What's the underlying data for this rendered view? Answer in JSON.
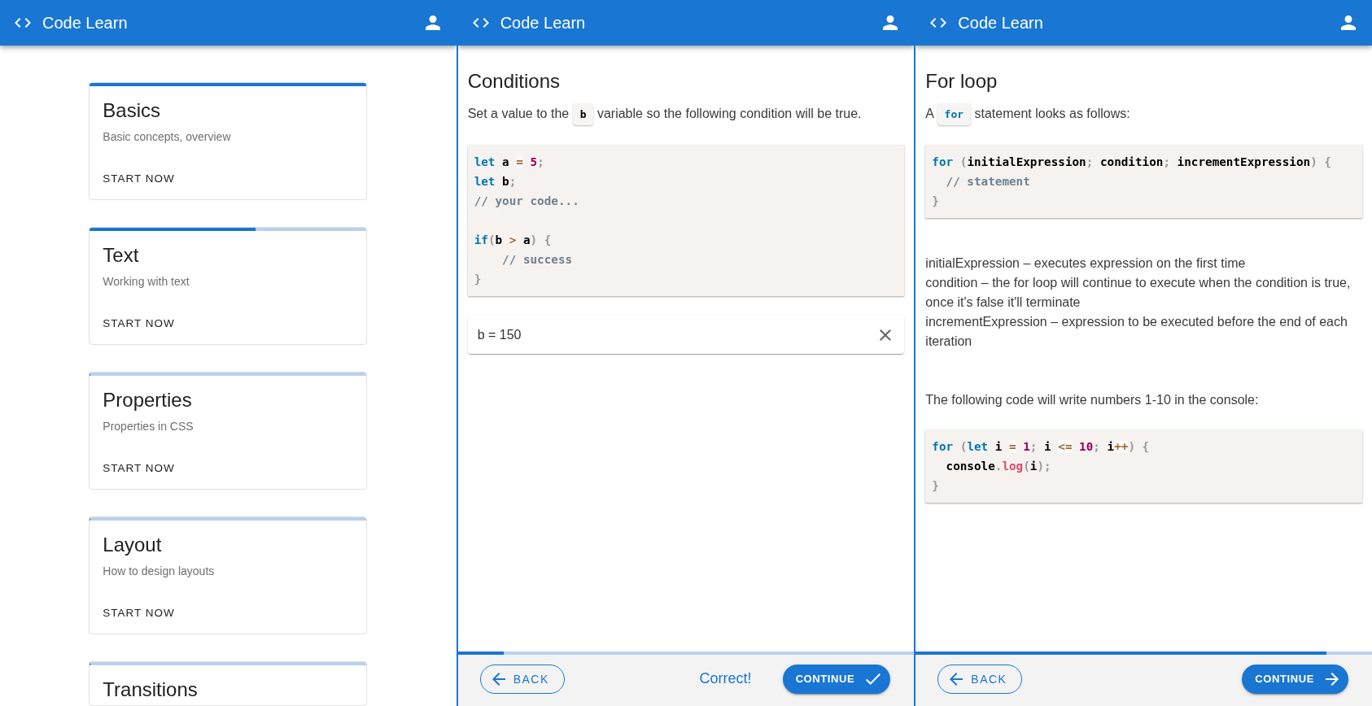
{
  "panels": [
    {
      "kind": "courses",
      "app_bar": {
        "title": "Code Learn"
      },
      "cards": [
        {
          "title": "Basics",
          "subtitle": "Basic concepts, overview",
          "action": "START NOW",
          "level": 1
        },
        {
          "title": "Text",
          "subtitle": "Working with text",
          "action": "START NOW",
          "level": 0.6
        },
        {
          "title": "Properties",
          "subtitle": "Properties in CSS",
          "action": "START NOW",
          "level": 0
        },
        {
          "title": "Layout",
          "subtitle": "How to design layouts",
          "action": "START NOW",
          "level": 0
        },
        {
          "title": "Transitions",
          "level": 0
        }
      ]
    },
    {
      "kind": "lesson",
      "app_bar": {
        "title": "Code Learn"
      },
      "title": "Conditions",
      "blocks": [
        {
          "kind": "paragraph",
          "parts": [
            {
              "kind": "text",
              "text": "Set a value to the"
            },
            {
              "kind": "code",
              "tokens": [
                {
                  "kind": "plain",
                  "text": "b"
                }
              ]
            },
            {
              "kind": "text",
              "text": "variable so the following condition will be true."
            }
          ]
        },
        {
          "kind": "code",
          "lines": [
            {
              "kind": "code",
              "tokens": [
                {
                  "kind": "keyword",
                  "text": "let"
                },
                {
                  "kind": "plain",
                  "text": " a "
                },
                {
                  "kind": "operator",
                  "text": "="
                },
                {
                  "kind": "number",
                  "text": " 5"
                },
                {
                  "kind": "punctuation",
                  "text": ";"
                }
              ]
            },
            {
              "kind": "code",
              "tokens": [
                {
                  "kind": "keyword",
                  "text": "let"
                },
                {
                  "kind": "plain",
                  "text": " b"
                },
                {
                  "kind": "punctuation",
                  "text": ";"
                }
              ]
            },
            {
              "kind": "code",
              "tokens": [
                {
                  "kind": "comment",
                  "text": "// your code..."
                }
              ]
            },
            {
              "kind": "blank"
            },
            {
              "kind": "code",
              "tokens": [
                {
                  "kind": "keyword",
                  "text": "if"
                },
                {
                  "kind": "punctuation",
                  "text": "("
                },
                {
                  "kind": "plain",
                  "text": "b "
                },
                {
                  "kind": "operator",
                  "text": ">"
                },
                {
                  "kind": "plain",
                  "text": " a"
                },
                {
                  "kind": "punctuation",
                  "text": ")"
                },
                {
                  "kind": "punctuation",
                  "text": " {"
                }
              ]
            },
            {
              "kind": "code",
              "tokens": [
                {
                  "kind": "comment",
                  "text": "    // success"
                }
              ]
            },
            {
              "kind": "code",
              "tokens": [
                {
                  "kind": "punctuation",
                  "text": "}"
                }
              ]
            }
          ]
        },
        {
          "kind": "answer",
          "value": "b = 150"
        }
      ],
      "progress": {
        "level": 0.1
      },
      "footer": {
        "back": "BACK",
        "status": "Correct!",
        "continue": "CONTINUE",
        "solved": true
      }
    },
    {
      "kind": "lesson",
      "app_bar": {
        "title": "Code Learn"
      },
      "title": "For loop",
      "blocks": [
        {
          "kind": "paragraph",
          "parts": [
            {
              "kind": "text",
              "text": "A"
            },
            {
              "kind": "code",
              "tokens": [
                {
                  "kind": "keyword",
                  "text": "for"
                }
              ]
            },
            {
              "kind": "text",
              "text": "statement looks as follows:"
            }
          ]
        },
        {
          "kind": "code",
          "lines": [
            {
              "kind": "code",
              "tokens": [
                {
                  "kind": "keyword",
                  "text": "for"
                },
                {
                  "kind": "punctuation",
                  "text": " ("
                },
                {
                  "kind": "plain",
                  "text": "initialExpression"
                },
                {
                  "kind": "punctuation",
                  "text": ";"
                },
                {
                  "kind": "plain",
                  "text": " condition"
                },
                {
                  "kind": "punctuation",
                  "text": ";"
                },
                {
                  "kind": "plain",
                  "text": " incrementExpression"
                },
                {
                  "kind": "punctuation",
                  "text": ")"
                },
                {
                  "kind": "punctuation",
                  "text": " {"
                }
              ]
            },
            {
              "kind": "code",
              "tokens": [
                {
                  "kind": "comment",
                  "text": "  // statement"
                }
              ]
            },
            {
              "kind": "code",
              "tokens": [
                {
                  "kind": "punctuation",
                  "text": "}"
                }
              ]
            }
          ]
        },
        {
          "kind": "definitions",
          "lines": [
            "initialExpression – executes expression on the first time",
            "condition – the for loop will continue to execute when the condition is true, once it's false it'll terminate",
            "incrementExpression – expression to be executed before the end of each iteration"
          ]
        },
        {
          "kind": "paragraph",
          "parts": [
            {
              "kind": "text",
              "text": "The following code will write numbers 1-10 in the console:"
            }
          ]
        },
        {
          "kind": "code",
          "lines": [
            {
              "kind": "code",
              "tokens": [
                {
                  "kind": "keyword",
                  "text": "for"
                },
                {
                  "kind": "punctuation",
                  "text": " ("
                },
                {
                  "kind": "keyword",
                  "text": "let"
                },
                {
                  "kind": "plain",
                  "text": " i "
                },
                {
                  "kind": "operator",
                  "text": "="
                },
                {
                  "kind": "number",
                  "text": " 1"
                },
                {
                  "kind": "punctuation",
                  "text": ";"
                },
                {
                  "kind": "plain",
                  "text": " i "
                },
                {
                  "kind": "operator",
                  "text": "<="
                },
                {
                  "kind": "number",
                  "text": " 10"
                },
                {
                  "kind": "punctuation",
                  "text": ";"
                },
                {
                  "kind": "plain",
                  "text": " i"
                },
                {
                  "kind": "operator",
                  "text": "++"
                },
                {
                  "kind": "punctuation",
                  "text": ")"
                },
                {
                  "kind": "punctuation",
                  "text": " {"
                }
              ]
            },
            {
              "kind": "code",
              "tokens": [
                {
                  "kind": "plain",
                  "text": "  console"
                },
                {
                  "kind": "punctuation",
                  "text": "."
                },
                {
                  "kind": "function",
                  "text": "log"
                },
                {
                  "kind": "punctuation",
                  "text": "("
                },
                {
                  "kind": "plain",
                  "text": "i"
                },
                {
                  "kind": "punctuation",
                  "text": ")"
                },
                {
                  "kind": "punctuation",
                  "text": ";"
                }
              ]
            },
            {
              "kind": "code",
              "tokens": [
                {
                  "kind": "punctuation",
                  "text": "}"
                }
              ]
            }
          ]
        }
      ],
      "progress": {
        "level": 0.9
      },
      "footer": {
        "back": "BACK",
        "continue": "CONTINUE",
        "solved": false
      }
    }
  ]
}
